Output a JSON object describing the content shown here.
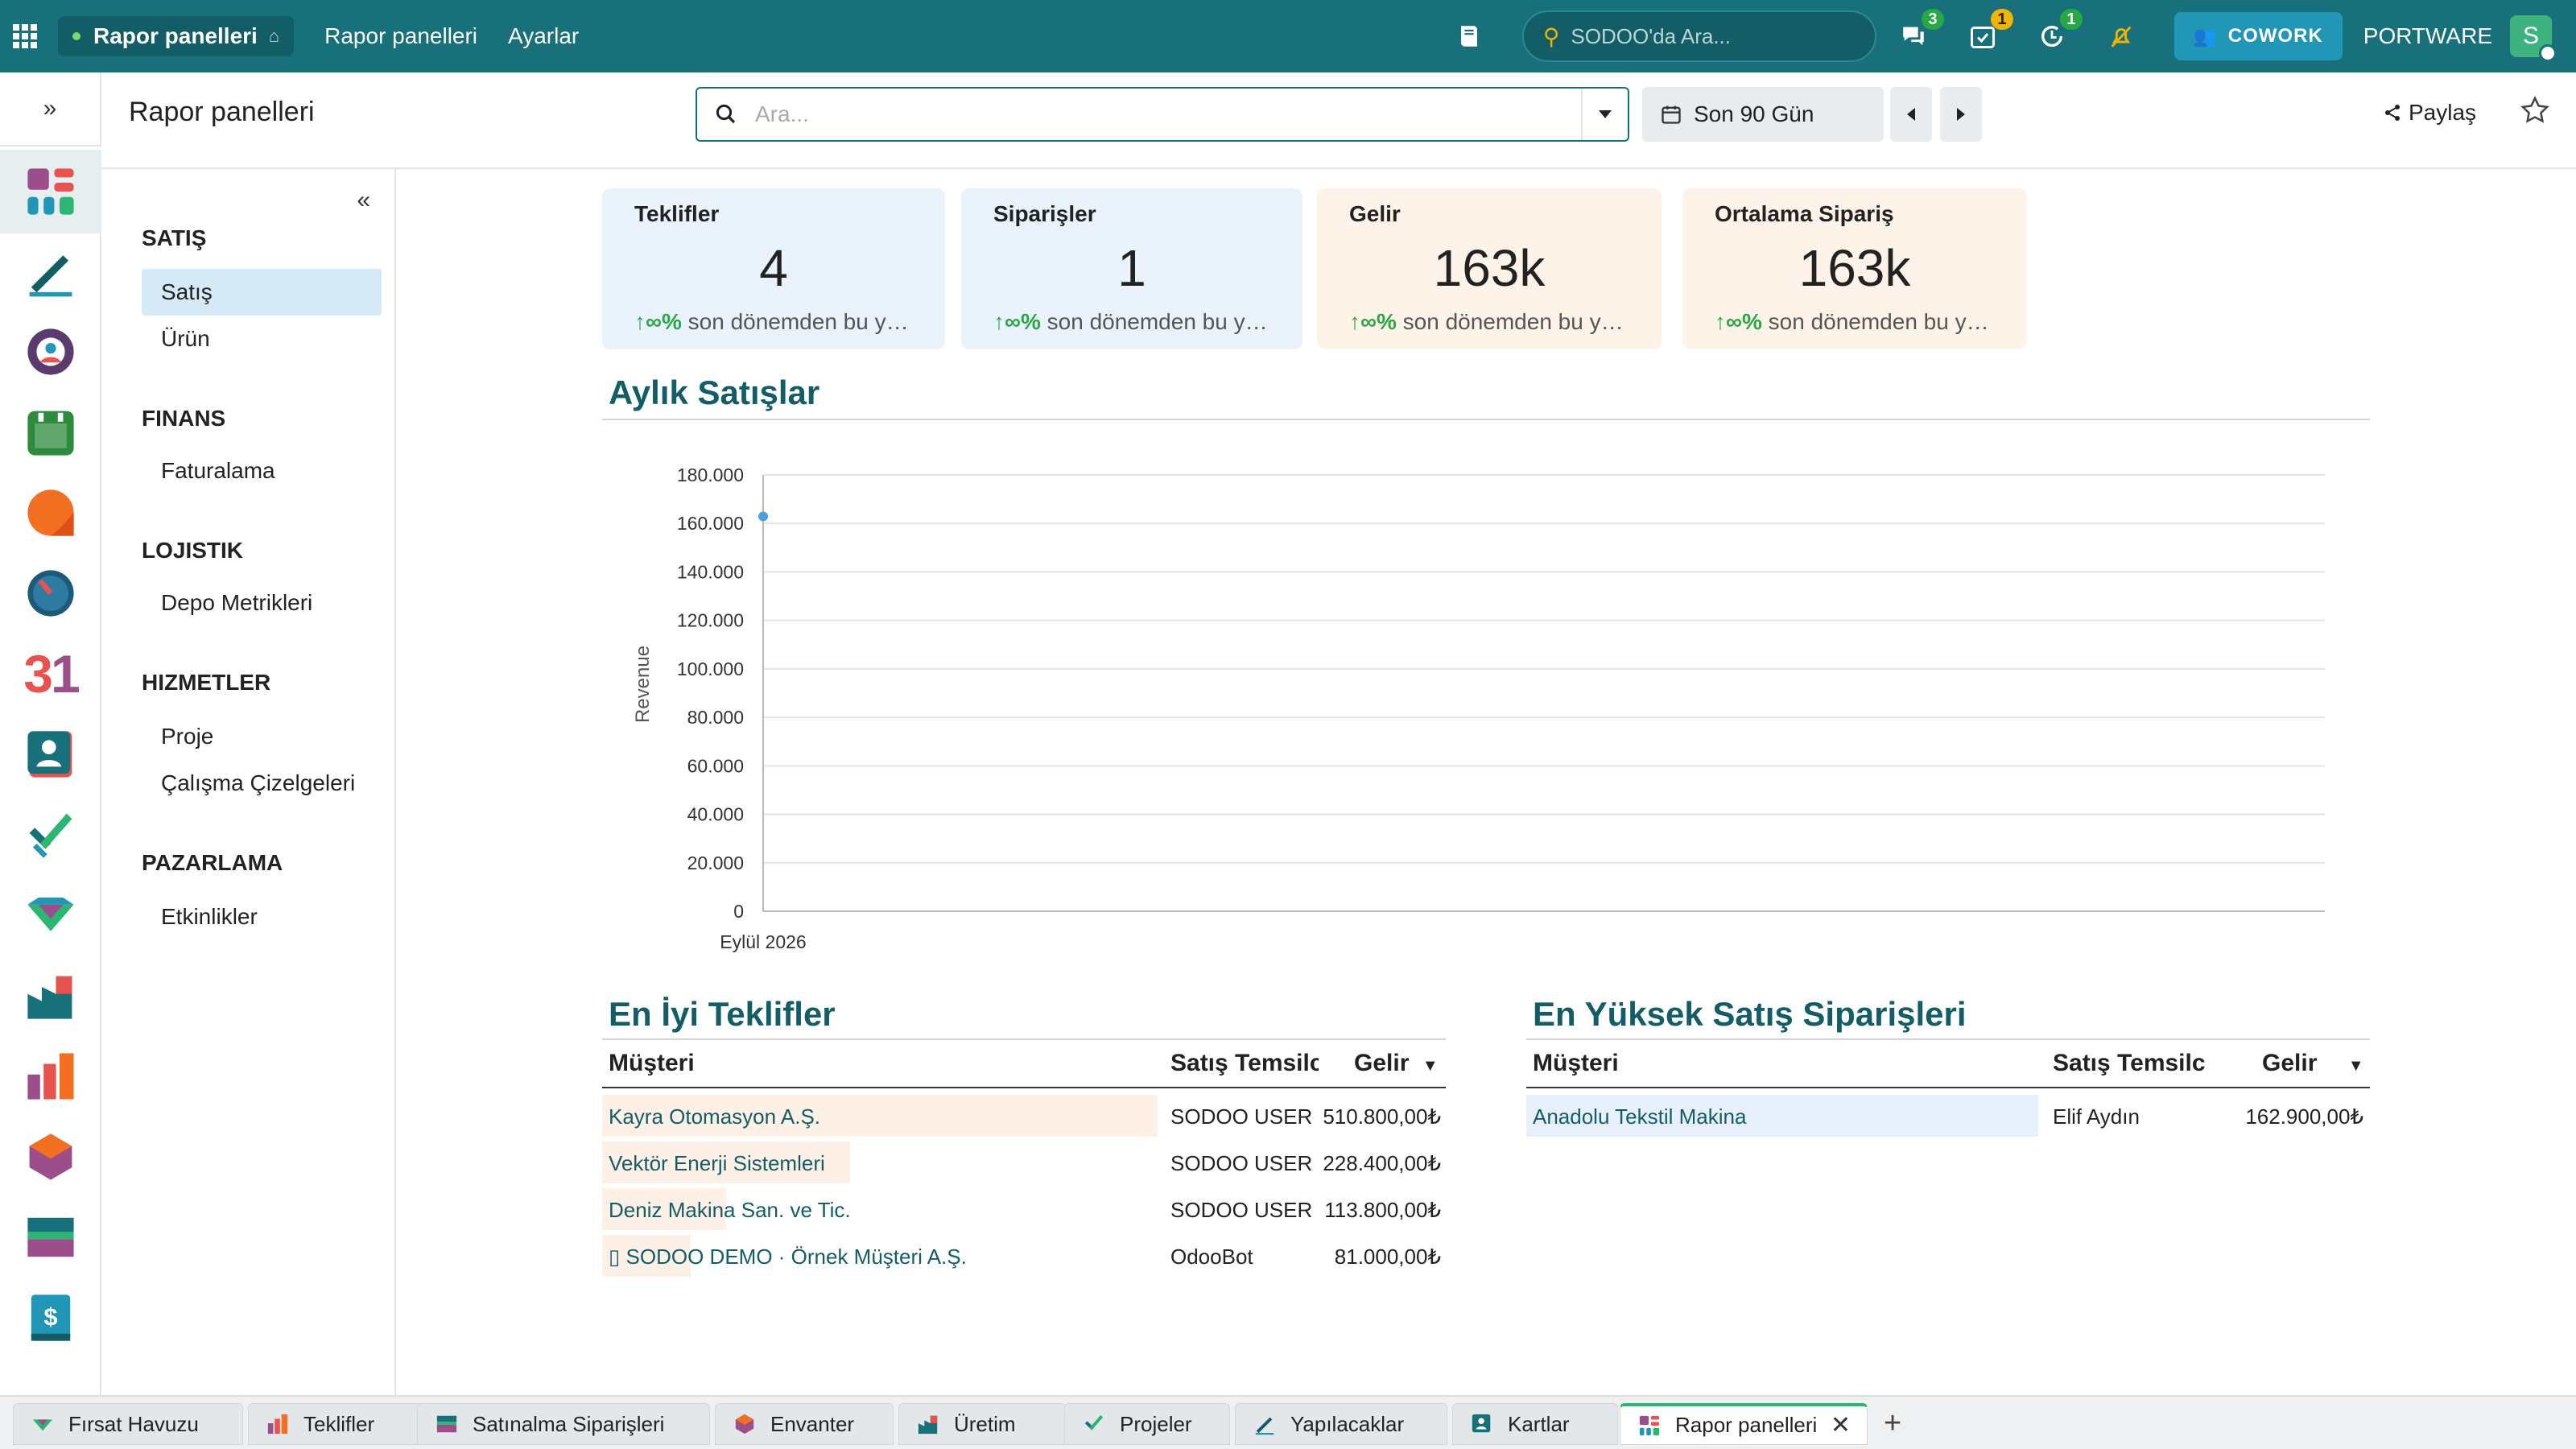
{
  "topbar": {
    "app_name": "Rapor panelleri",
    "menu": [
      "Rapor panelleri",
      "Ayarlar"
    ],
    "search_placeholder": "SODOO'da Ara...",
    "badges": {
      "messages": "3",
      "activities": "1",
      "updates": "1"
    },
    "cowork_label": "COWORK",
    "company": "PORTWARE",
    "user_initial": "S"
  },
  "control_panel": {
    "breadcrumb": "Rapor panelleri",
    "search_placeholder": "Ara...",
    "date_filter": "Son 90 Gün",
    "share_label": "Paylaş"
  },
  "sidenav": {
    "sections": [
      {
        "title": "SATIŞ",
        "items": [
          "Satış",
          "Ürün"
        ]
      },
      {
        "title": "FINANS",
        "items": [
          "Faturalama"
        ]
      },
      {
        "title": "LOJISTIK",
        "items": [
          "Depo Metrikleri"
        ]
      },
      {
        "title": "HIZMETLER",
        "items": [
          "Proje",
          "Çalışma Çizelgeleri"
        ]
      },
      {
        "title": "PAZARLAMA",
        "items": [
          "Etkinlikler"
        ]
      }
    ],
    "active_item": "Satış"
  },
  "kpis": [
    {
      "title": "Teklifler",
      "value": "4",
      "change_icon": "↑∞%",
      "change_text": "son dönemden bu y…",
      "bg": "#eaf3fc"
    },
    {
      "title": "Siparişler",
      "value": "1",
      "change_icon": "↑∞%",
      "change_text": "son dönemden bu y…",
      "bg": "#eaf3fc"
    },
    {
      "title": "Gelir",
      "value": "163k",
      "change_icon": "↑∞%",
      "change_text": "son dönemden bu y…",
      "bg": "#fdf3e8"
    },
    {
      "title": "Ortalama Sipariş",
      "value": "163k",
      "change_icon": "↑∞%",
      "change_text": "son dönemden bu y…",
      "bg": "#fdf3e8"
    }
  ],
  "monthly_sales": {
    "title": "Aylık Satışlar"
  },
  "chart_data": {
    "type": "line",
    "x": [
      "Eylül 2026"
    ],
    "series": [
      {
        "values": [
          162900
        ]
      }
    ],
    "xlabel": "",
    "ylabel": "Revenue",
    "ylim": [
      0,
      180000
    ],
    "yticks": [
      "0",
      "20.000",
      "40.000",
      "60.000",
      "80.000",
      "100.000",
      "120.000",
      "140.000",
      "160.000",
      "180.000"
    ],
    "grid": true,
    "color": "#4a9fe0"
  },
  "top_quotes": {
    "title": "En İyi Teklifler",
    "columns": [
      "Müşteri",
      "Satış Temsilc",
      "Gelir"
    ],
    "rows": [
      {
        "customer": "Kayra Otomasyon A.Ş.",
        "rep": "SODOO USER",
        "revenue": "510.800,00₺",
        "fraction": 1.0
      },
      {
        "customer": "Vektör Enerji Sistemleri",
        "rep": "SODOO USER",
        "revenue": "228.400,00₺",
        "fraction": 0.447
      },
      {
        "customer": "Deniz Makina San. ve Tic.",
        "rep": "SODOO USER",
        "revenue": "113.800,00₺",
        "fraction": 0.223
      },
      {
        "customer": "▯ SODOO DEMO · Örnek Müşteri A.Ş.",
        "rep": "OdooBot",
        "revenue": "81.000,00₺",
        "fraction": 0.159
      }
    ]
  },
  "top_orders": {
    "title": "En Yüksek Satış Siparişleri",
    "columns": [
      "Müşteri",
      "Satış Temsilc",
      "Gelir"
    ],
    "rows": [
      {
        "customer": "Anadolu Tekstil Makina",
        "rep": "Elif Aydın",
        "revenue": "162.900,00₺",
        "fraction": 1.0
      }
    ]
  },
  "tabs": [
    "Fırsat Havuzu",
    "Teklifler",
    "Satınalma Siparişleri",
    "Envanter",
    "Üretim",
    "Projeler",
    "Yapılacaklar",
    "Kartlar",
    "Rapor panelleri"
  ],
  "active_tab": "Rapor panelleri"
}
